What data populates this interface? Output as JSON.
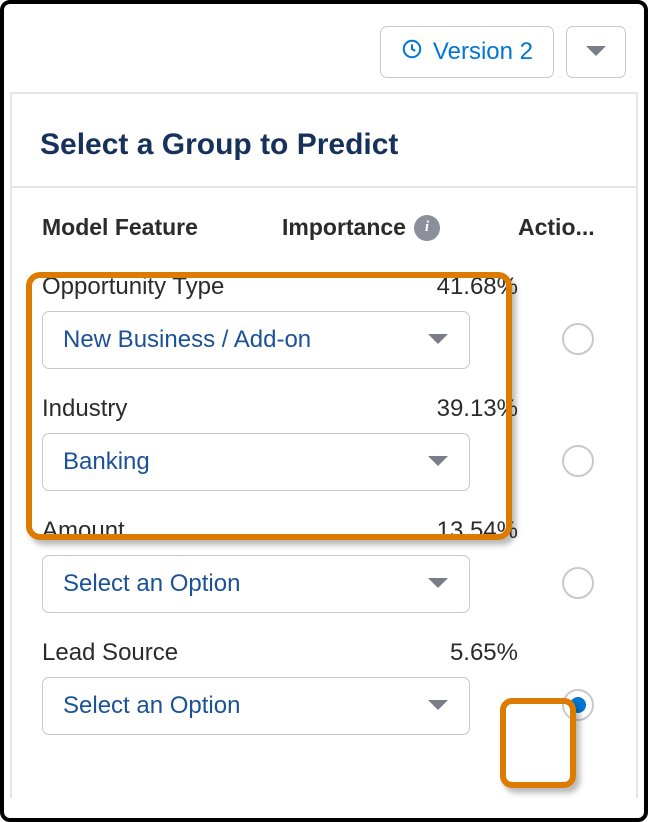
{
  "topbar": {
    "version_label": "Version 2"
  },
  "panel": {
    "title": "Select a Group to Predict"
  },
  "columns": {
    "feature": "Model Feature",
    "importance": "Importance",
    "action": "Actio..."
  },
  "features": [
    {
      "name": "Opportunity Type",
      "importance": "41.68%",
      "selected": "New Business / Add-on",
      "radio_checked": false
    },
    {
      "name": "Industry",
      "importance": "39.13%",
      "selected": "Banking",
      "radio_checked": false
    },
    {
      "name": "Amount",
      "importance": "13.54%",
      "selected": "Select an Option",
      "radio_checked": false
    },
    {
      "name": "Lead Source",
      "importance": "5.65%",
      "selected": "Select an Option",
      "radio_checked": true
    }
  ],
  "icons": {
    "info": "i"
  }
}
